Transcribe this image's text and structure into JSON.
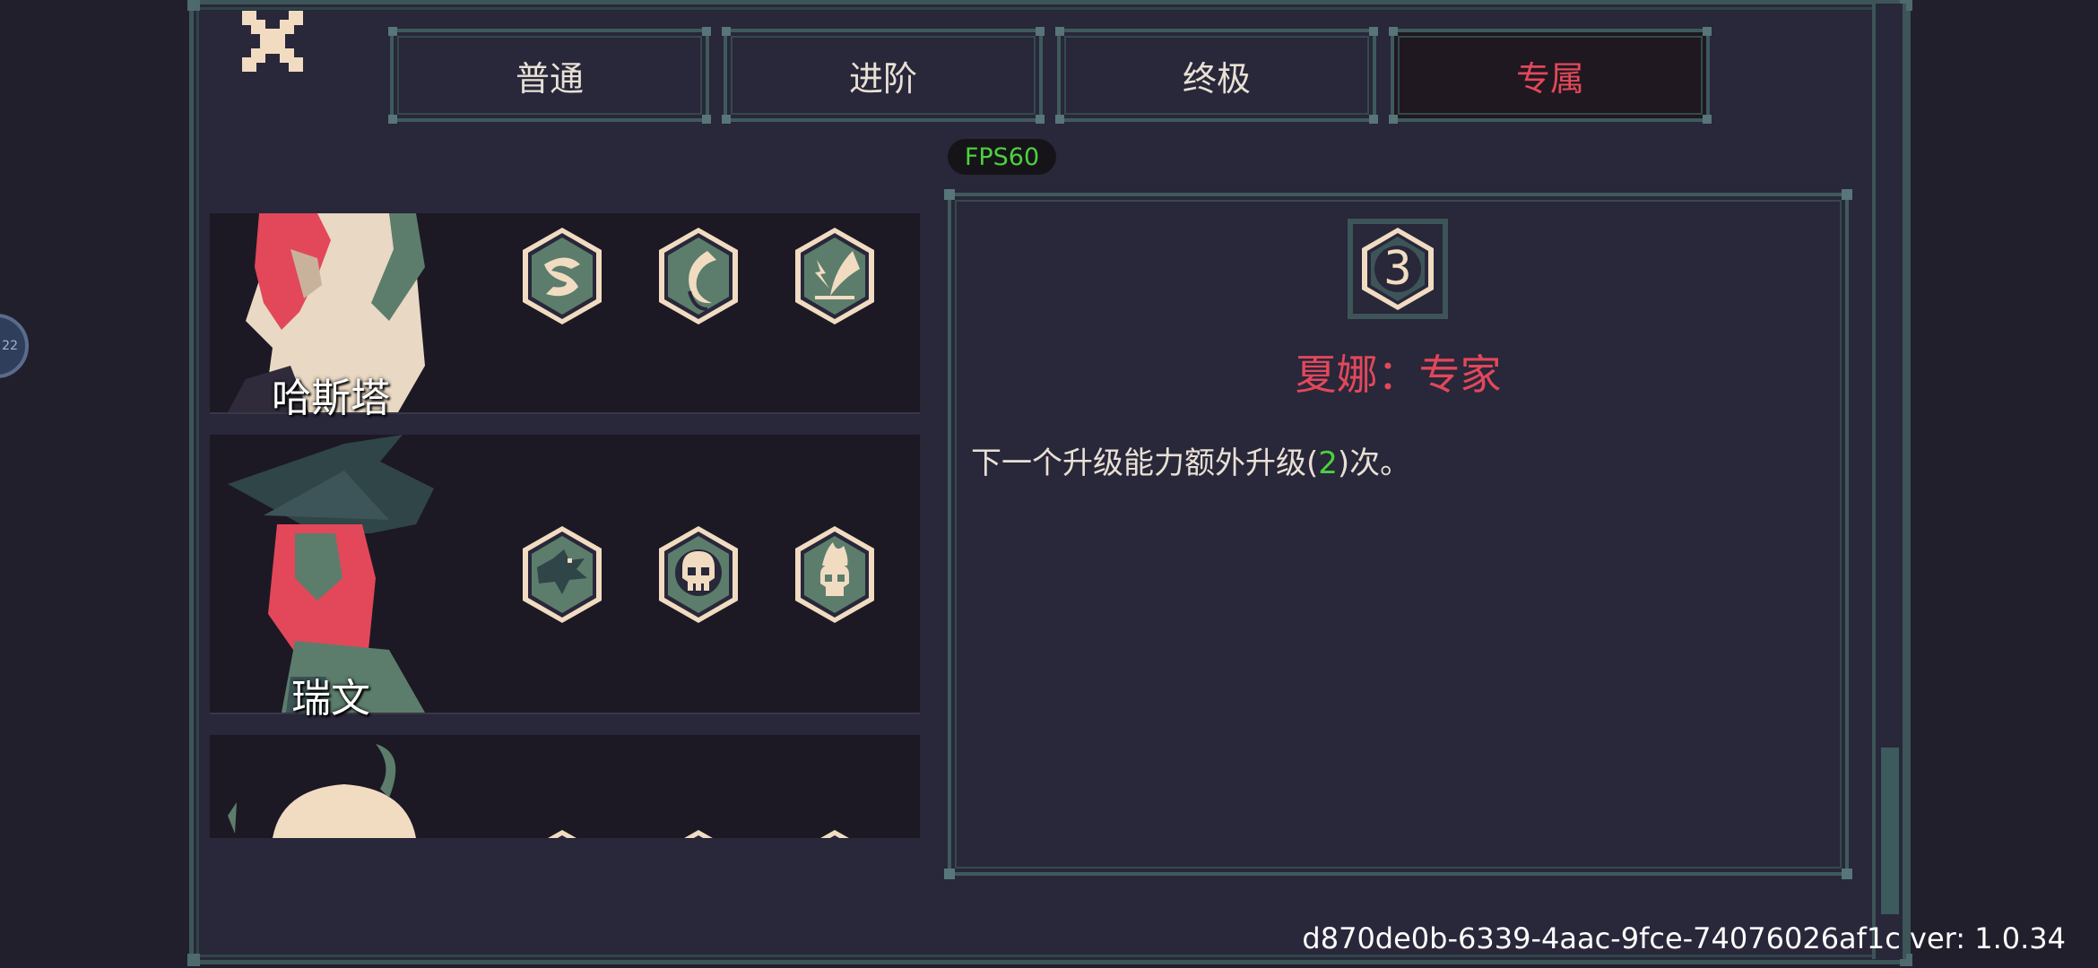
{
  "tabs": [
    {
      "label": "普通",
      "active": false
    },
    {
      "label": "进阶",
      "active": false
    },
    {
      "label": "终极",
      "active": false
    },
    {
      "label": "专属",
      "active": true
    }
  ],
  "fps": "FPS60",
  "characters": [
    {
      "name": "哈斯塔",
      "skills": [
        "wind-swirl-icon",
        "crescent-moon-icon",
        "lightning-plume-icon"
      ]
    },
    {
      "name": "瑞文",
      "skills": [
        "crow-icon",
        "skull-icon",
        "flaming-skull-icon"
      ]
    },
    {
      "name": "",
      "skills": [
        "skill-icon",
        "skill-icon",
        "skill-icon"
      ]
    }
  ],
  "detail": {
    "badge_number": "3",
    "title": "夏娜：专家",
    "desc_before": "下一个升级能力额外升级(",
    "desc_value": "2",
    "desc_after": ")次。"
  },
  "version": "d870de0b-6339-4aac-9fce-74076026af1c ver: 1.0.34",
  "side_bubble": "22",
  "colors": {
    "background": "#221f2c",
    "panel": "#29273a",
    "border": "#3d5558",
    "accent_red": "#e2485a",
    "accent_green": "#4cd13e",
    "text": "#e8e0d4",
    "icon_fill": "#5c7d6b",
    "icon_cream": "#f1dcc2"
  }
}
